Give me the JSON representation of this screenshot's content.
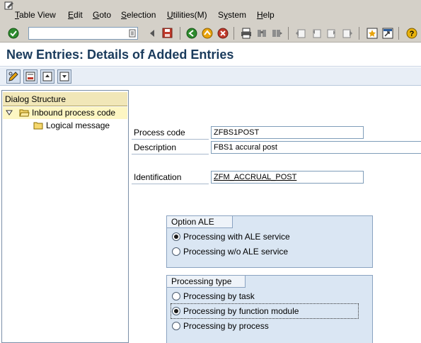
{
  "menubar": {
    "items": [
      {
        "label": "Table View",
        "underline": "T"
      },
      {
        "label": "Edit",
        "underline": "E"
      },
      {
        "label": "Goto",
        "underline": "G"
      },
      {
        "label": "Selection",
        "underline": "S"
      },
      {
        "label": "Utilities(M)",
        "underline": "U"
      },
      {
        "label": "System",
        "underline": "y"
      },
      {
        "label": "Help",
        "underline": "H"
      }
    ]
  },
  "toolbar": {
    "command_value": "",
    "icons": [
      "enter-icon",
      "back-icon",
      "save-icon",
      "green-back-icon",
      "exit-icon",
      "cancel-icon",
      "print-icon",
      "find-icon",
      "find-next-icon",
      "first-page-icon",
      "previous-page-icon",
      "next-page-icon",
      "last-page-icon",
      "new-session-icon",
      "shortcut-icon",
      "help-icon"
    ]
  },
  "title": "New Entries: Details of Added Entries",
  "left_panel": {
    "header": "Dialog Structure",
    "tree": [
      {
        "label": "Inbound process code",
        "expanded": true,
        "selected": true
      },
      {
        "label": "Logical message",
        "expanded": false,
        "selected": false
      }
    ]
  },
  "form": {
    "process_code": {
      "label": "Process code",
      "value": "ZFBS1POST"
    },
    "description": {
      "label": "Description",
      "value": "FBS1 accural post"
    },
    "identification": {
      "label": "Identification",
      "value": "ZFM_ACCRUAL_POST"
    }
  },
  "option_ale": {
    "title": "Option ALE",
    "options": [
      {
        "label": "Processing with ALE service",
        "selected": true
      },
      {
        "label": "Processing w/o ALE service",
        "selected": false
      }
    ]
  },
  "processing_type": {
    "title": "Processing type",
    "options": [
      {
        "label": "Processing by task",
        "selected": false
      },
      {
        "label": "Processing by function module",
        "selected": true
      },
      {
        "label": "Processing by process",
        "selected": false
      }
    ]
  },
  "colors": {
    "title_text": "#1a3b5c",
    "toolbar_bg": "#d4d0c8",
    "group_bg": "#dae6f3",
    "tree_header_bg": "#f1e7b8"
  }
}
